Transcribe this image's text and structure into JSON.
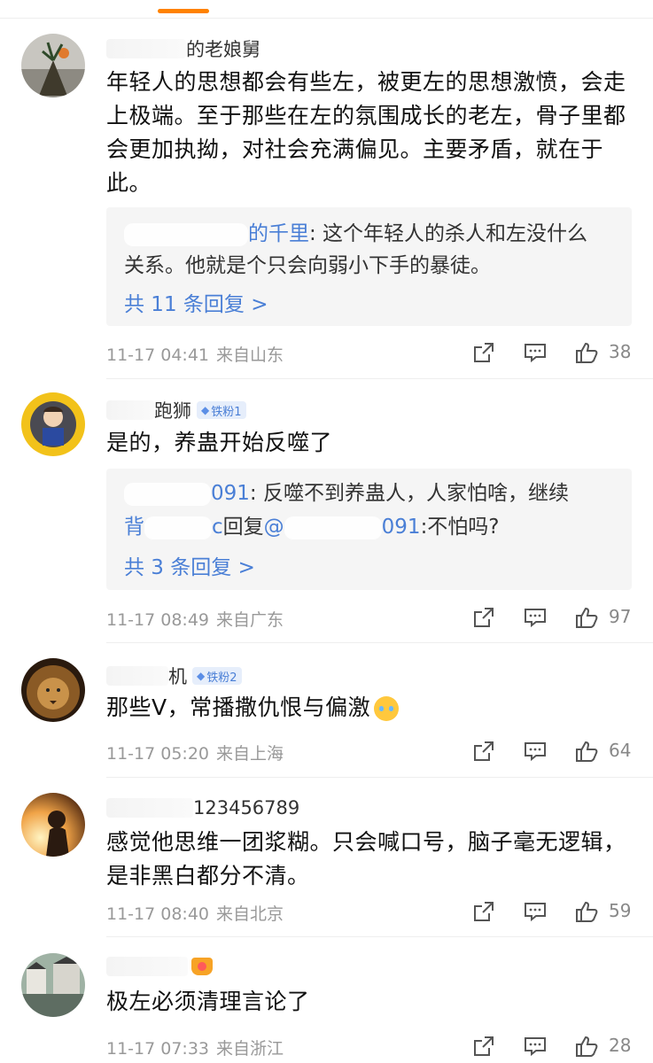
{
  "comments": [
    {
      "username_visible": "的老娘舅",
      "text": "年轻人的思想都会有些左，被更左的思想激愤，会走上极端。至于那些在左的氛围成长的老左，骨子里都会更加执拗，对社会充满偏见。主要矛盾，就在于此。",
      "replies": [
        {
          "name": "的千里",
          "text": ": 这个年轻人的杀人和左没什么",
          "text2": "关系。他就是个只会向弱小下手的暴徒。"
        }
      ],
      "more_replies": "共 11 条回复 >",
      "date": "11-17 04:41",
      "location": "来自山东",
      "likes": "38"
    },
    {
      "username_visible": "跑狮",
      "badge": "铁粉1",
      "text": "是的，养蛊开始反噬了",
      "replies": [
        {
          "name": "091",
          "text": ": 反噬不到养蛊人，人家怕啥，继续"
        },
        {
          "name": "背",
          "name_tail": "c",
          "mid": "回复",
          "at": "@",
          "name2": "091",
          "text": ":不怕吗?"
        }
      ],
      "more_replies": "共 3 条回复 >",
      "date": "11-17 08:49",
      "location": "来自广东",
      "likes": "97"
    },
    {
      "username_visible": "机",
      "badge": "铁粉2",
      "text": "那些V，常播撒仇恨与偏激",
      "emoji": "crying-emoji",
      "date": "11-17 05:20",
      "location": "来自上海",
      "likes": "64"
    },
    {
      "username_visible": "123456789",
      "text": "感觉他思维一团浆糊。只会喊口号，脑子毫无逻辑，是非黑白都分不清。",
      "date": "11-17 08:40",
      "location": "来自北京",
      "likes": "59"
    },
    {
      "username_visible": "",
      "text": "极左必须清理言论了",
      "date": "11-17 07:33",
      "location": "来自浙江",
      "likes": "28"
    }
  ],
  "colors": {
    "accent": "#ff8200",
    "link": "#4a7fd6",
    "meta": "#999999"
  },
  "icons": {
    "share": "share-icon",
    "comment": "comment-icon",
    "like": "thumbs-up-icon",
    "badge": "diamond-icon"
  }
}
